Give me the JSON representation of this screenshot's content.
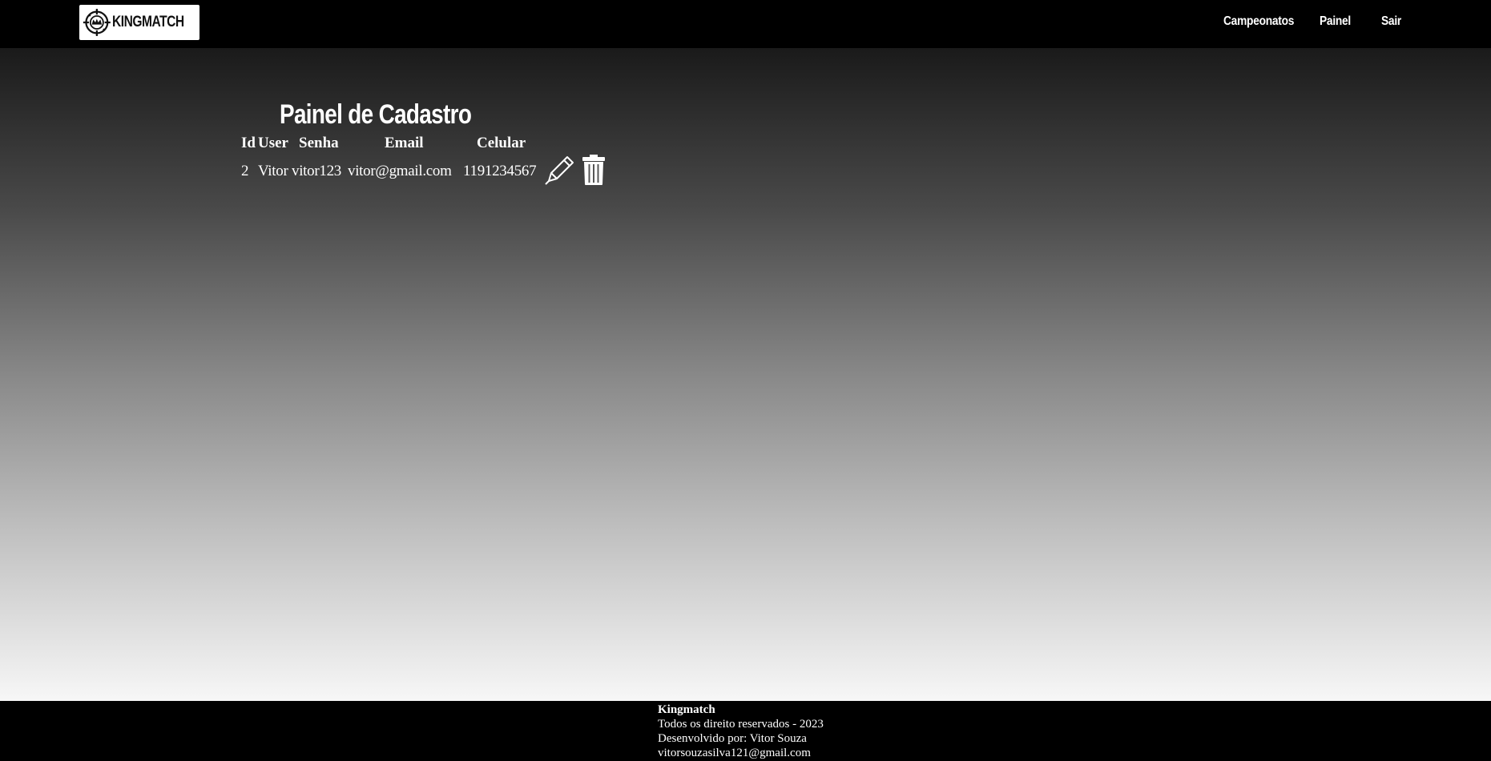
{
  "header": {
    "logo_text": "KINGMATCH",
    "nav": [
      {
        "label": "Campeonatos"
      },
      {
        "label": "Painel"
      },
      {
        "label": "Sair"
      }
    ]
  },
  "panel": {
    "title": "Painel de Cadastro",
    "columns": [
      "Id",
      "User",
      "Senha",
      "Email",
      "Celular"
    ],
    "rows": [
      {
        "id": "2",
        "user": "Vitor",
        "senha": "vitor123",
        "email": "vitor@gmail.com",
        "celular": "1191234567",
        "actions": [
          "edit-icon",
          "trash-icon"
        ]
      }
    ]
  },
  "footer": {
    "brand": "Kingmatch",
    "rights": "Todos os direito reservados - 2023",
    "developer": "Desenvolvido por: Vitor Souza",
    "email": "vitorsouzasilva121@gmail.com"
  },
  "colors": {
    "header_bg": "#000000",
    "footer_bg": "#000000",
    "gradient_top": "#1a1a1a",
    "gradient_bottom": "#f7f7f7",
    "text": "#ffffff"
  }
}
